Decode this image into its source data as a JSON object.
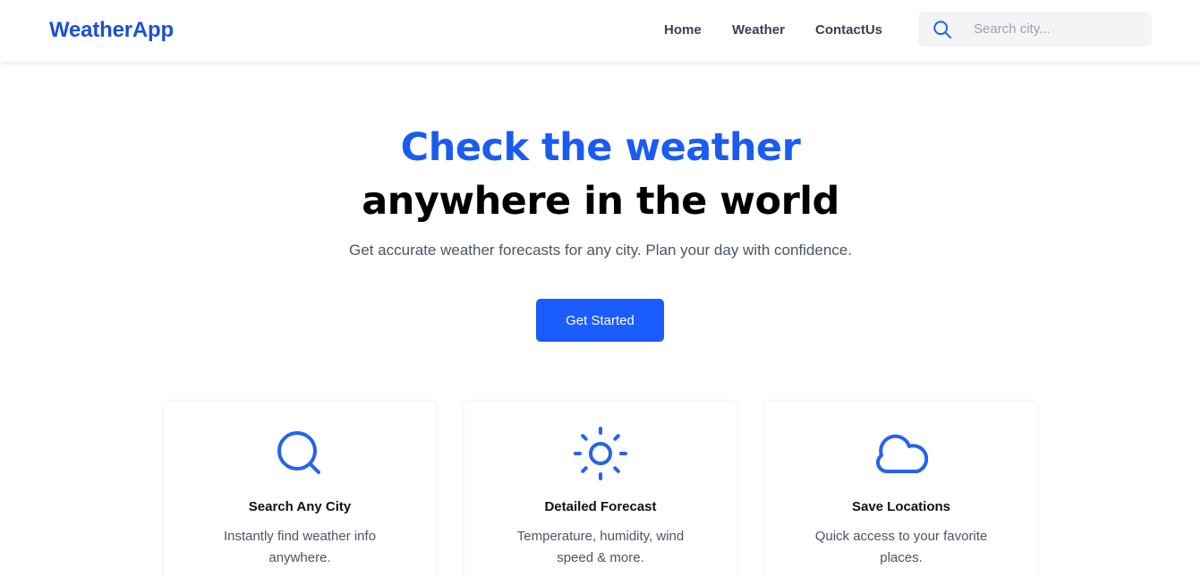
{
  "header": {
    "brand": "WeatherApp",
    "nav": {
      "home": "Home",
      "weather": "Weather",
      "contact": "ContactUs"
    },
    "search": {
      "placeholder": "Search city...",
      "icon": "search-icon"
    }
  },
  "hero": {
    "title_line1": "Check the weather",
    "title_line2": "anywhere in the world",
    "subtitle": "Get accurate weather forecasts for any city. Plan your day with confidence.",
    "cta_label": "Get Started"
  },
  "features": [
    {
      "icon": "search-icon",
      "title": "Search Any City",
      "description": "Instantly find weather info anywhere."
    },
    {
      "icon": "sun-icon",
      "title": "Detailed Forecast",
      "description": "Temperature, humidity, wind speed & more."
    },
    {
      "icon": "cloud-icon",
      "title": "Save Locations",
      "description": "Quick access to your favorite places."
    }
  ],
  "colors": {
    "brand": "#1d4ed8",
    "accent": "#1a5cff",
    "text_muted": "#4b5563",
    "search_bg": "#f3f4f6"
  }
}
